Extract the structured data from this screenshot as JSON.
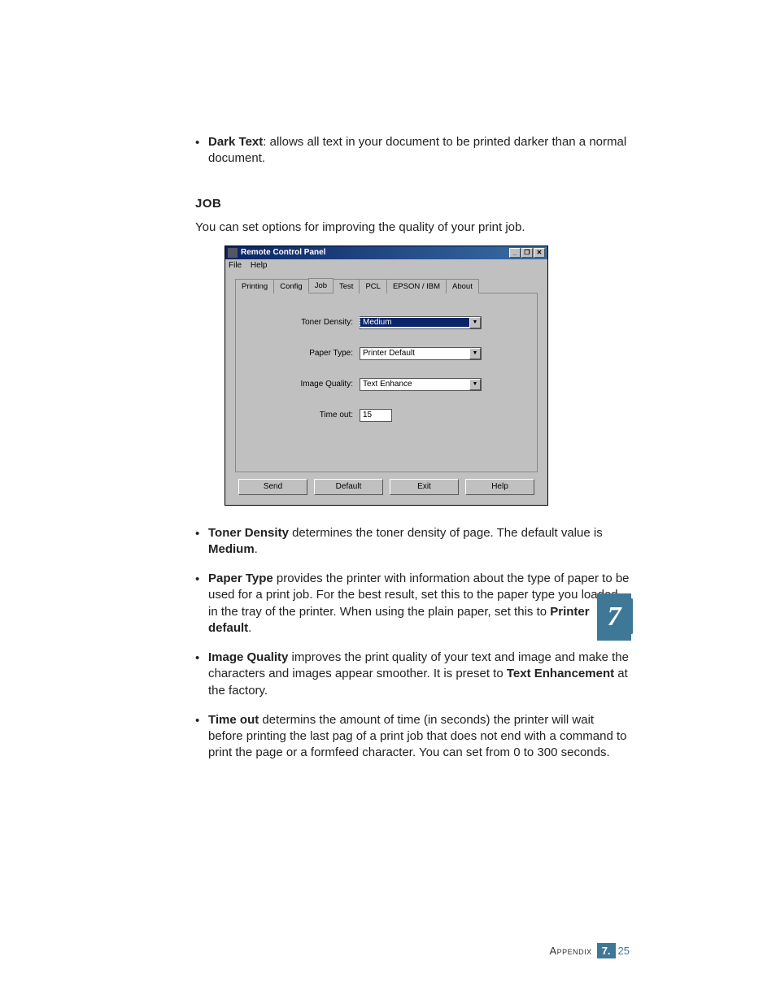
{
  "top_bullet": {
    "bold": "Dark Text",
    "rest": ": allows all text in your document to be printed darker than a normal document."
  },
  "section_heading": "JOB",
  "intro": "You can set options for improving the quality of your print job.",
  "dialog": {
    "title": "Remote Control Panel",
    "menu": {
      "file": "File",
      "help": "Help"
    },
    "tabs": [
      "Printing",
      "Config",
      "Job",
      "Test",
      "PCL",
      "EPSON / IBM",
      "About"
    ],
    "fields": {
      "toner_density": {
        "label": "Toner Density:",
        "value": "Medium"
      },
      "paper_type": {
        "label": "Paper Type:",
        "value": "Printer Default"
      },
      "image_quality": {
        "label": "Image Quality:",
        "value": "Text Enhance"
      },
      "time_out": {
        "label": "Time out:",
        "value": "15"
      }
    },
    "buttons": {
      "send": "Send",
      "default": "Default",
      "exit": "Exit",
      "help": "Help"
    },
    "title_btn": {
      "min": "_",
      "max": "❐",
      "close": "✕"
    }
  },
  "descriptions": [
    {
      "bold": "Toner Density",
      "rest": " determines the toner density of page. The default value is ",
      "bold2": "Medium",
      "rest2": "."
    },
    {
      "bold": "Paper Type",
      "rest": " provides the printer with information about the type of paper to be used for a print job. For the best result, set this to the paper type you loaded in the tray of the printer. When using the plain paper, set this to ",
      "bold2": "Printer default",
      "rest2": "."
    },
    {
      "bold": "Image Quality",
      "rest": " improves the print quality of your text and image and make the characters and images appear smoother. It is preset to ",
      "bold2": "Text Enhancement",
      "rest2": " at the factory."
    },
    {
      "bold": "Time out",
      "rest": " determins the amount of time (in seconds) the printer will wait before printing the last pag of a print job that does not end with a command to print the page or a formfeed character. You can set from 0 to 300 seconds.",
      "bold2": "",
      "rest2": ""
    }
  ],
  "chapter_tab": "7",
  "footer": {
    "label": "Appendix",
    "chapter": "7.",
    "page": "25"
  }
}
